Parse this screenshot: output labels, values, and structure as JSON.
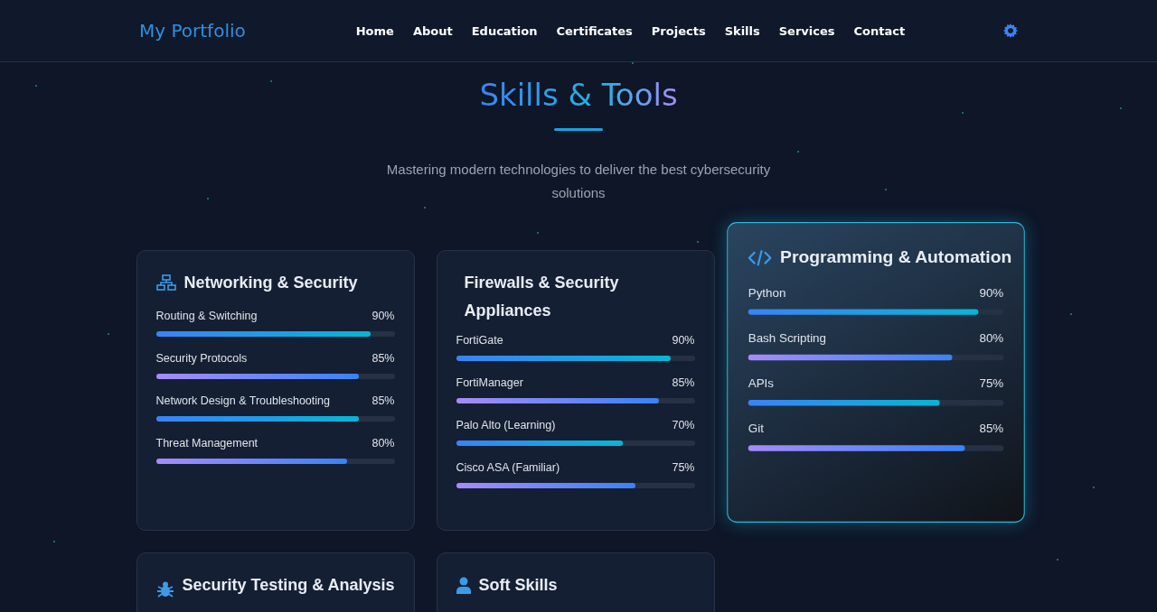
{
  "brand": "My Portfolio",
  "nav": [
    {
      "label": "Home"
    },
    {
      "label": "About"
    },
    {
      "label": "Education"
    },
    {
      "label": "Certificates"
    },
    {
      "label": "Projects"
    },
    {
      "label": "Skills"
    },
    {
      "label": "Services"
    },
    {
      "label": "Contact"
    }
  ],
  "heading": "Skills & Tools",
  "subtitle": "Mastering modern technologies to deliver the best cybersecurity solutions",
  "cards": [
    {
      "title": "Networking & Security",
      "kind": "network",
      "highlighted": false,
      "skills": [
        {
          "name": "Routing & Switching",
          "reading": "90%",
          "level": 0.9
        },
        {
          "name": "Security Protocols",
          "reading": "85%",
          "level": 0.85
        },
        {
          "name": "Network Design & Troubleshooting",
          "reading": "85%",
          "level": 0.85
        },
        {
          "name": "Threat Management",
          "reading": "80%",
          "level": 0.8
        }
      ]
    },
    {
      "title": "Firewalls & Security Appliances",
      "kind": "plain",
      "highlighted": false,
      "skills": [
        {
          "name": "FortiGate",
          "reading": "90%",
          "level": 0.9
        },
        {
          "name": "FortiManager",
          "reading": "85%",
          "level": 0.85
        },
        {
          "name": "Palo Alto (Learning)",
          "reading": "70%",
          "level": 0.7
        },
        {
          "name": "Cisco ASA (Familiar)",
          "reading": "75%",
          "level": 0.75
        }
      ]
    },
    {
      "title": "Programming & Automation",
      "kind": "code",
      "highlighted": true,
      "skills": [
        {
          "name": "Python",
          "reading": "90%",
          "level": 0.9
        },
        {
          "name": "Bash Scripting",
          "reading": "80%",
          "level": 0.8
        },
        {
          "name": "APIs",
          "reading": "75%",
          "level": 0.75
        },
        {
          "name": "Git",
          "reading": "85%",
          "level": 0.85
        }
      ]
    },
    {
      "title": "Security Testing & Analysis",
      "kind": "bug",
      "highlighted": false
    },
    {
      "title": "Soft Skills",
      "kind": "person",
      "highlighted": false
    }
  ]
}
